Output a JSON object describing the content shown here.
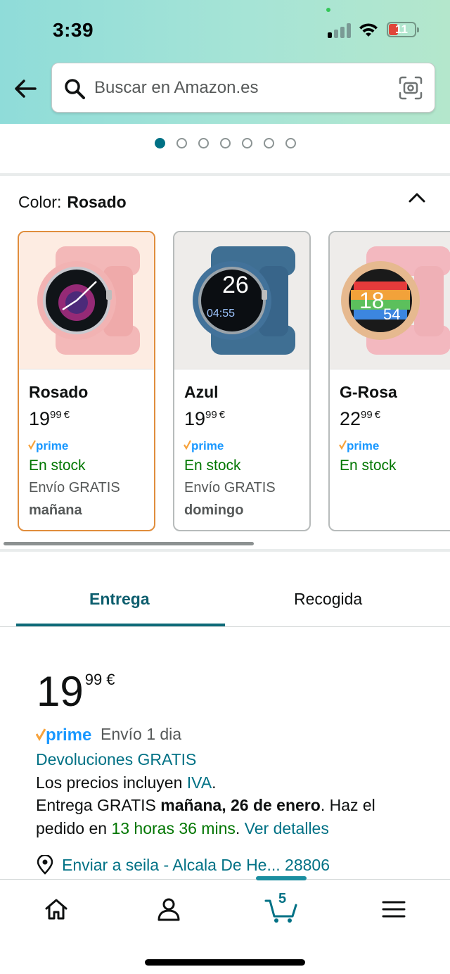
{
  "status_bar": {
    "time": "3:39",
    "battery": "11"
  },
  "search": {
    "placeholder": "Buscar en Amazon.es"
  },
  "carousel": {
    "dot_count": 7,
    "active_index": 0
  },
  "color_section": {
    "label": "Color:",
    "selected_value": "Rosado"
  },
  "variants": [
    {
      "name": "Rosado",
      "price_whole": "19",
      "price_fraction": "99",
      "currency": "€",
      "prime": "prime",
      "stock": "En stock",
      "shipping": "Envío GRATIS",
      "delivery_day": "mañana"
    },
    {
      "name": "Azul",
      "price_whole": "19",
      "price_fraction": "99",
      "currency": "€",
      "prime": "prime",
      "stock": "En stock",
      "shipping": "Envío GRATIS",
      "delivery_day": "domingo"
    },
    {
      "name": "G-Rosa",
      "price_whole": "22",
      "price_fraction": "99",
      "currency": "€",
      "prime": "prime",
      "stock": "En stock",
      "shipping": "",
      "delivery_day": ""
    }
  ],
  "tabs": [
    {
      "label": "Entrega",
      "active": true
    },
    {
      "label": "Recogida",
      "active": false
    }
  ],
  "offer": {
    "price_whole": "19",
    "price_fraction": "99",
    "currency": "€",
    "prime_label": "prime",
    "prime_shipping": "Envío 1 dia",
    "returns": "Devoluciones GRATIS",
    "tax_prefix": "Los precios incluyen",
    "tax_link": "IVA",
    "tax_suffix": ".",
    "delivery_prefix": "Entrega GRATIS",
    "delivery_date": "mañana, 26 de enero",
    "delivery_suffix": ". Haz el",
    "order_prefix": "pedido en",
    "order_countdown": "13 horas 36 mins",
    "order_sep": ".",
    "details_link": "Ver detalles",
    "deliver_to": "Enviar a seila - Alcala De He... 28806"
  },
  "bottom_nav": {
    "cart_count": "5"
  },
  "colors": {
    "accent": "#007185",
    "stock_green": "#007600",
    "prime_orange": "#F7A23B",
    "prime_blue": "#1A98FF",
    "selected_border": "#E08D3C"
  }
}
